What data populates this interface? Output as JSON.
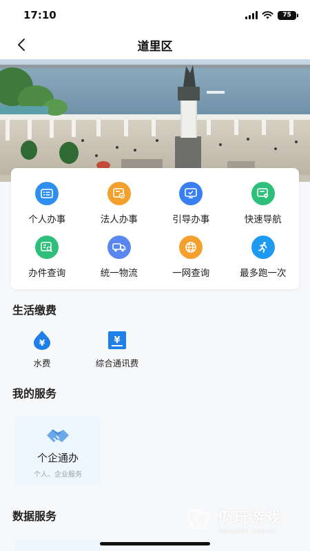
{
  "status_bar": {
    "time": "17:10",
    "battery": "75",
    "icons": [
      "signal-icon",
      "wifi-icon",
      "battery-icon"
    ]
  },
  "header": {
    "title": "道里区",
    "back_icon": "chevron-left-icon"
  },
  "banner": {
    "image": "city-monument-riverside-photo"
  },
  "services_grid": [
    {
      "label": "个人办事",
      "icon": "id-card-icon",
      "color": "#2f8ff0"
    },
    {
      "label": "法人办事",
      "icon": "certificate-icon",
      "color": "#f4a02c"
    },
    {
      "label": "引导办事",
      "icon": "monitor-check-icon",
      "color": "#3a7ff0"
    },
    {
      "label": "快速导航",
      "icon": "map-pin-card-icon",
      "color": "#2ec07a"
    },
    {
      "label": "办件查询",
      "icon": "doc-search-icon",
      "color": "#2ec07a"
    },
    {
      "label": "统一物流",
      "icon": "truck-icon",
      "color": "#5a86f0"
    },
    {
      "label": "一网查询",
      "icon": "globe-icon",
      "color": "#f4a02c"
    },
    {
      "label": "最多跑一次",
      "icon": "runner-icon",
      "color": "#1e9bf0"
    }
  ],
  "life_payment": {
    "title": "生活缴费",
    "items": [
      {
        "label": "水费",
        "icon": "water-drop-icon",
        "color": "#1e7fe8"
      },
      {
        "label": "综合通讯费",
        "icon": "yuan-bill-icon",
        "color": "#1e7fe8"
      }
    ]
  },
  "my_services": {
    "title": "我的服务",
    "card": {
      "title": "个企通办",
      "subtitle": "个人、企业服务",
      "icon": "handshake-icon"
    }
  },
  "data_services": {
    "title": "数据服务"
  },
  "watermark": {
    "cn": "仍玩游戏",
    "en": "Rengwan Games"
  }
}
